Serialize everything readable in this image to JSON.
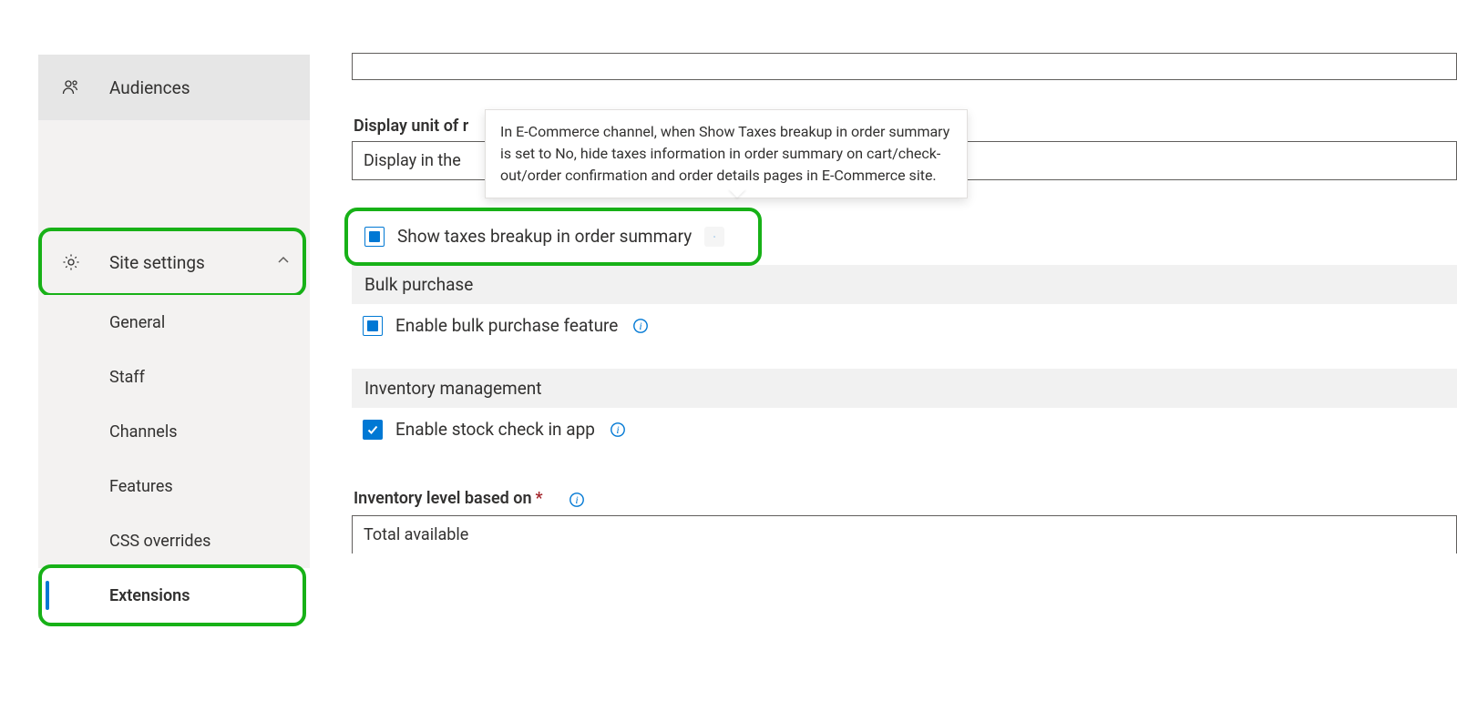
{
  "sidebar": {
    "audiences": "Audiences",
    "site_settings": "Site settings",
    "subitems": {
      "general": "General",
      "staff": "Staff",
      "channels": "Channels",
      "features": "Features",
      "css": "CSS overrides",
      "extensions": "Extensions"
    }
  },
  "main": {
    "display_unit_label_partial": "Display unit of r",
    "display_unit_value_partial": "Display in the ",
    "tooltip": "In E-Commerce channel, when Show Taxes breakup in order summary is set to No, hide taxes information in order summary on cart/check-out/order confirmation and order details pages in E-Commerce site.",
    "show_taxes_label": "Show taxes breakup in order summary",
    "bulk_hdr": "Bulk purchase",
    "bulk_label": "Enable bulk purchase feature",
    "inv_hdr": "Inventory management",
    "stock_label": "Enable stock check in app",
    "inv_level_label": "Inventory level based on",
    "inv_level_value": "Total available"
  }
}
